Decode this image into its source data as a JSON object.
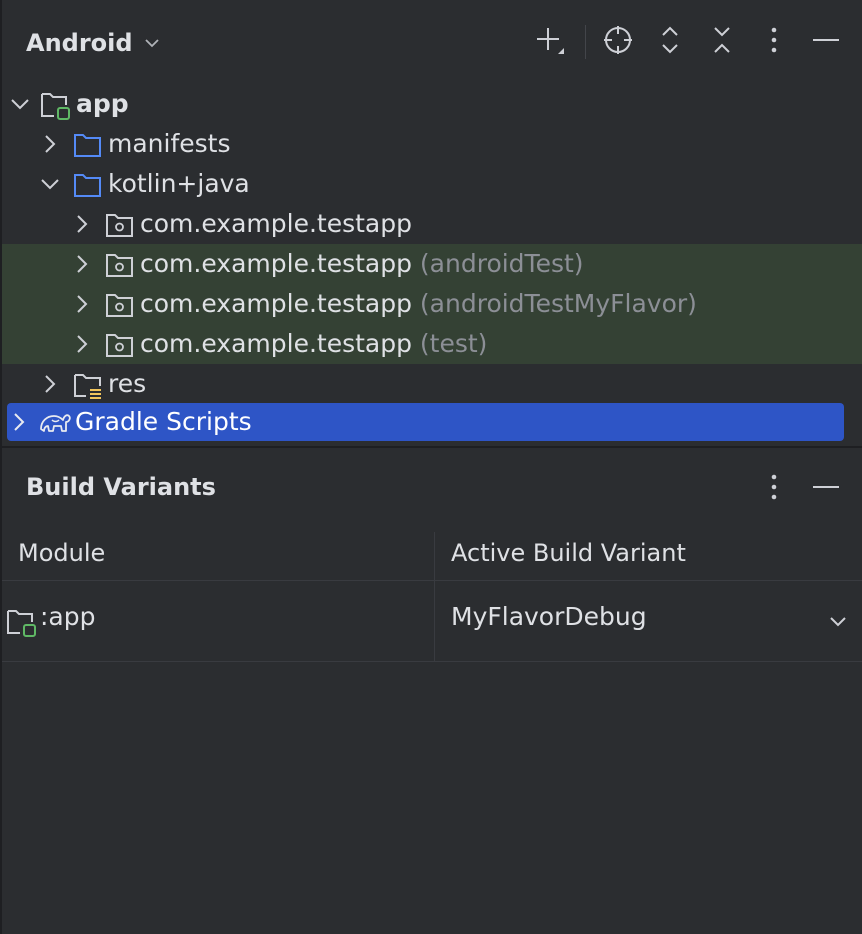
{
  "header": {
    "view_title": "Android",
    "view_chevron_icon": "chevron-down-icon",
    "toolbar_icons": [
      "add-icon",
      "locate-icon",
      "expand-all-icon",
      "collapse-all-icon",
      "more-vertical-icon",
      "minimize-icon"
    ]
  },
  "tree": {
    "app": "app",
    "manifests": "manifests",
    "kotlin_java": "kotlin+java",
    "pkg_main": "com.example.testapp",
    "pkg_android_test": "com.example.testapp",
    "pkg_android_test_suffix": "(androidTest)",
    "pkg_android_test_flavor": "com.example.testapp",
    "pkg_android_test_flavor_suffix": "(androidTestMyFlavor)",
    "pkg_test": "com.example.testapp",
    "pkg_test_suffix": "(test)",
    "res": "res",
    "gradle_scripts": "Gradle Scripts"
  },
  "build_variants": {
    "title": "Build Variants",
    "columns": [
      "Module",
      "Active Build Variant"
    ],
    "rows": [
      {
        "module": ":app",
        "variant": "MyFlavorDebug"
      }
    ]
  },
  "colors": {
    "background": "#2b2d30",
    "selection": "#2e55c6",
    "test_highlight": "#344134",
    "folder_blue": "#548af7",
    "module_green": "#5fb865",
    "resource_yellow": "#f2c55c",
    "dim_text": "#8c8f96"
  }
}
